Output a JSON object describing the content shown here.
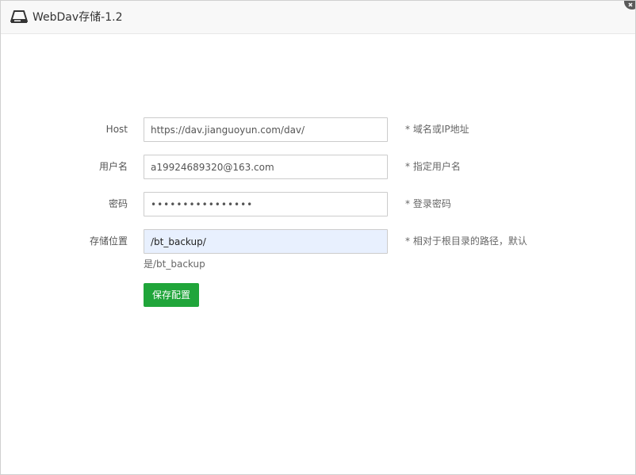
{
  "window": {
    "title": "WebDav存储-1.2",
    "logo_icon": "cloud-drive-icon",
    "close_icon": "close-icon"
  },
  "form": {
    "host": {
      "label": "Host",
      "value": "https://dav.jianguoyun.com/dav/",
      "hint": "* 域名或IP地址"
    },
    "username": {
      "label": "用户名",
      "value": "a19924689320@163.com",
      "hint": "* 指定用户名"
    },
    "password": {
      "label": "密码",
      "value": "••••••••••••••••",
      "hint": "* 登录密码"
    },
    "path": {
      "label": "存储位置",
      "value": "/bt_backup/",
      "hint": "* 相对于根目录的路径，默认",
      "hint_cont": "是/bt_backup"
    },
    "save_label": "保存配置"
  },
  "colors": {
    "accent": "#20a53a",
    "autofill_bg": "#e8f0fe"
  }
}
